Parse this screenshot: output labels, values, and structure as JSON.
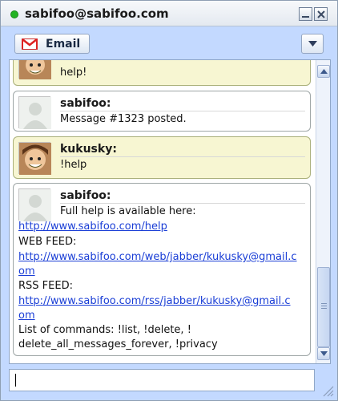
{
  "window": {
    "title": "sabifoo@sabifoo.com",
    "status_color": "#23b323"
  },
  "toolbar": {
    "email_label": "Email",
    "email_icon": "gmail-icon",
    "menu_icon": "chevron-down-icon"
  },
  "messages": [
    {
      "sender": "",
      "avatar": "kukusky-avatar",
      "lines": [
        "help!"
      ]
    },
    {
      "sender": "sabifoo:",
      "avatar": "default-avatar",
      "lines": [
        "Message #1323 posted."
      ]
    },
    {
      "sender": "kukusky:",
      "avatar": "kukusky-avatar",
      "lines": [
        "!help"
      ]
    },
    {
      "sender": "sabifoo:",
      "avatar": "default-avatar",
      "first_line": "Full help is available here:",
      "body": [
        {
          "text": "http://www.sabifoo.com/help",
          "link": true
        },
        {
          "text": "WEB FEED:",
          "link": false
        },
        {
          "text": "http://www.sabifoo.com/web/jabber/kukusky@gmail.c",
          "link": true
        },
        {
          "text": "om",
          "link": true
        },
        {
          "text": "RSS FEED:",
          "link": false
        },
        {
          "text": "http://www.sabifoo.com/rss/jabber/kukusky@gmail.c",
          "link": true
        },
        {
          "text": "om",
          "link": true
        },
        {
          "text": "List of commands: !list, !delete, !",
          "link": false
        },
        {
          "text": "delete_all_messages_forever, !privacy",
          "link": false
        }
      ]
    }
  ],
  "input": {
    "value": ""
  },
  "colors": {
    "accent": "#c3d9ff",
    "kukusky_bubble": "#f7f6d2",
    "link": "#1a3ed6"
  }
}
